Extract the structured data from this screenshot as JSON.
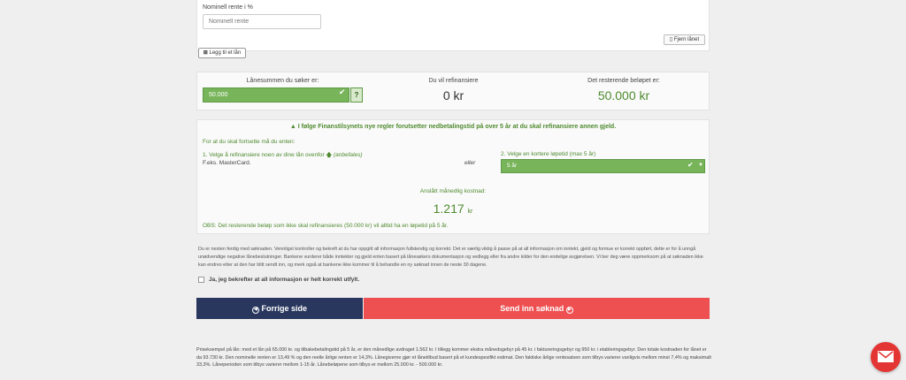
{
  "loan_form": {
    "rate_label": "Nominell rente i %",
    "rate_placeholder": "Nominell rente",
    "remove_button": "Fjern lånet",
    "add_button": "Legg til et lån"
  },
  "summary": {
    "requested_label": "Lånesummen du søker er:",
    "requested_value": "50.000",
    "help": "?",
    "refinance_label": "Du vil refinansiere",
    "refinance_value": "0 kr",
    "remaining_label": "Det resterende beløpet er:",
    "remaining_value": "50.000 kr"
  },
  "notice": {
    "warning": "I følge Finanstilsynets nye regler forutsetter nedbetalingstid på over 5 år at du skal refinansiere annen gjeld.",
    "intro": "For at du skal fortsette må du enten:",
    "option1_text": "1. Velge å refinansiere noen av dine lån ovenfor",
    "option1_recommended": "(anbefales)",
    "option1_example": "F.eks. MasterCard.",
    "or_text": "eller",
    "option2_text": "2. Velge en kortere løpetid (max 5 år)",
    "option2_selected": "5 år",
    "monthly_label": "Anslått månedlig kostnad:",
    "monthly_value": "1.217",
    "monthly_unit": "kr",
    "obs": "OBS: Det resterende beløp som ikke skal refinansieres (50.000 kr) vil alltid ha en løpetid på 5 år."
  },
  "disclaimer": "Du er nesten ferdig med søknaden. Vennligst kontroller og bekreft at du har oppgitt all informasjon fullstendig og korrekt. Det er særlig viktig å passe på at all informasjon om inntekt, gjeld og formue er korrekt oppført, dette er for å unngå unødvendige negative lånebeslutninger. Bankene vurderer både inntekter og gjeld enten basert på lånesøkers dokumentasjon og vedlegg eller fra andre kilder for den endelige avgjørelsen. Vi ber deg være oppmerksom på at søknaden ikke kan endres etter at den har blitt sendt inn, og merk også at bankene ikke kommer til å behandle en ny søknad innen de neste 30 dagene.",
  "confirm_label": "Ja, jeg bekrefter at all informasjon er helt korrekt utfylt.",
  "buttons": {
    "prev": "Forrige side",
    "send": "Send inn søknad"
  },
  "footer": "Priseksempel på lån: med et lån på 65.000 kr. og tilbakebetalingstid på 5 år, er den månedlige avdraget 1.562 kr. I tillegg kommer ekstra månedsgebyr på 45 kr. i faktureringsgebyr og 950 kr. i etableringsgebyr. Den totale kostnaden for lånet er da 93.730 kr. Den nominelle renten er 13,49 % og den reelle årlige renten er 14,3%. Lånegiverne gjør et lånetilbud basert på et kundespesifikt estimat. Den faktiske årlige rentesatsen som tilbys varierer vanligvis mellom minst 7,4% og maksimalt 33,3%. Låneperioden som tilbys varierer mellom 1-15 år. Lånebeløpene som tilbys er mellom 25.000 kr. - 500.000 kr.",
  "colors": {
    "green": "#78b45a",
    "navy": "#29375e",
    "red": "#ee5051"
  }
}
